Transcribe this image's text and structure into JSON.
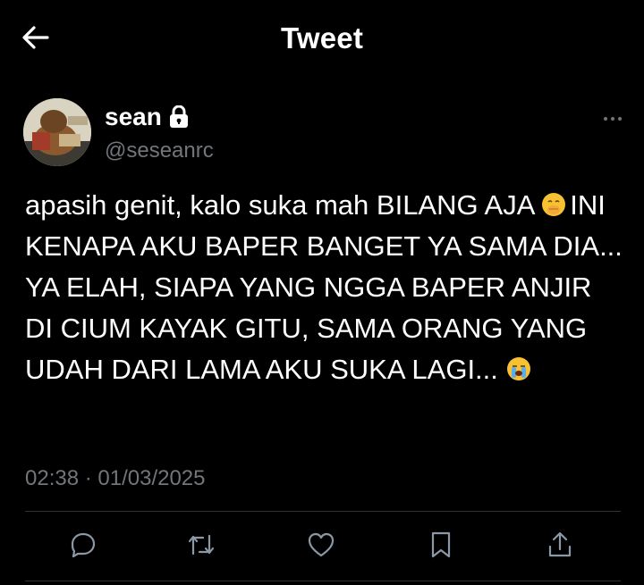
{
  "header": {
    "title": "Tweet",
    "back_icon": "arrow-left-icon"
  },
  "author": {
    "display_name": "sean",
    "handle": "@seseanrc",
    "protected_icon": "lock-icon"
  },
  "tweet": {
    "line1": "apasih genit, kalo suka mah BILANG AJA",
    "emoji1": "🤭",
    "line2": "INI KENAPA AKU BAPER BANGET YA SAMA DIA... YA ELAH, SIAPA YANG NGGA BAPER ANJIR DI CIUM KAYAK GITU, SAMA ORANG YANG UDAH DARI LAMA AKU SUKA LAGI...",
    "emoji2": "😭"
  },
  "meta": {
    "timestamp": "02:38 · 01/03/2025"
  },
  "actions": [
    "reply-icon",
    "retweet-icon",
    "like-icon",
    "bookmark-icon",
    "share-icon"
  ],
  "colors": {
    "background": "#000000",
    "text": "#ffffff",
    "secondary": "#71767b",
    "divider": "#2f3336"
  }
}
